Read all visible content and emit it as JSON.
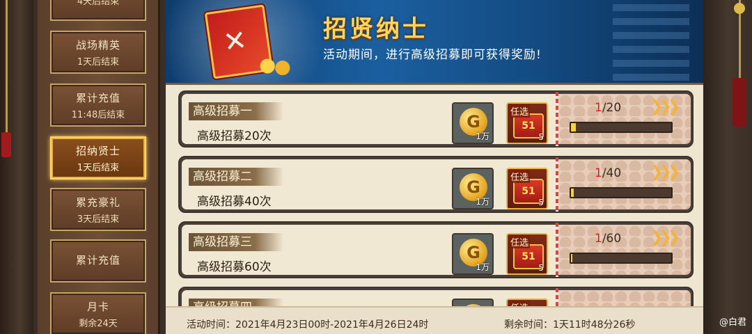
{
  "sidebar": {
    "items": [
      {
        "title": "",
        "subtitle": "4天后结束"
      },
      {
        "title": "战场精英",
        "subtitle": "1天后结束"
      },
      {
        "title": "累计充值",
        "subtitle": "11:48后结束"
      },
      {
        "title": "招纳贤士",
        "subtitle": "1天后结束"
      },
      {
        "title": "累充豪礼",
        "subtitle": "3天后结束"
      },
      {
        "title": "累计充值",
        "subtitle": ""
      },
      {
        "title": "月卡",
        "subtitle": "剩余24天"
      }
    ],
    "active_index": 3
  },
  "banner": {
    "title": "招贤纳士",
    "description": "活动期间，进行高级招募即可获得奖励!"
  },
  "tasks": [
    {
      "name": "高级招募一",
      "desc": "高级招募20次",
      "rewards": [
        {
          "icon": "gold-coin-icon",
          "label": "G",
          "qty": "1万"
        },
        {
          "icon": "gift-box-icon",
          "tag": "任选",
          "label": "51",
          "qty": "5"
        }
      ],
      "progress": {
        "current": "1",
        "total": "/20",
        "fraction": 0.05
      }
    },
    {
      "name": "高级招募二",
      "desc": "高级招募40次",
      "rewards": [
        {
          "icon": "gold-coin-icon",
          "label": "G",
          "qty": "1万"
        },
        {
          "icon": "gift-box-icon",
          "tag": "任选",
          "label": "51",
          "qty": "5"
        }
      ],
      "progress": {
        "current": "1",
        "total": "/40",
        "fraction": 0.025
      }
    },
    {
      "name": "高级招募三",
      "desc": "高级招募60次",
      "rewards": [
        {
          "icon": "gold-coin-icon",
          "label": "G",
          "qty": "1万"
        },
        {
          "icon": "gift-box-icon",
          "tag": "任选",
          "label": "51",
          "qty": "5"
        }
      ],
      "progress": {
        "current": "1",
        "total": "/60",
        "fraction": 0.017
      }
    },
    {
      "name": "高级招募四",
      "desc": "",
      "rewards": [
        {
          "icon": "gold-coin-icon",
          "label": "G",
          "qty": ""
        },
        {
          "icon": "gift-box-icon",
          "tag": "任选",
          "label": "",
          "qty": ""
        }
      ],
      "progress": {
        "current": "",
        "total": "",
        "fraction": 0
      }
    }
  ],
  "footer": {
    "activity_time": "活动时间：2021年4月23日00时-2021年4月26日24时",
    "remaining_time": "剩余时间：1天11时48分26秒"
  },
  "watermark": "@白君",
  "colors": {
    "accent": "#ffd65a",
    "progress_fill": "#f6d04a",
    "progress_current": "#d62020"
  }
}
